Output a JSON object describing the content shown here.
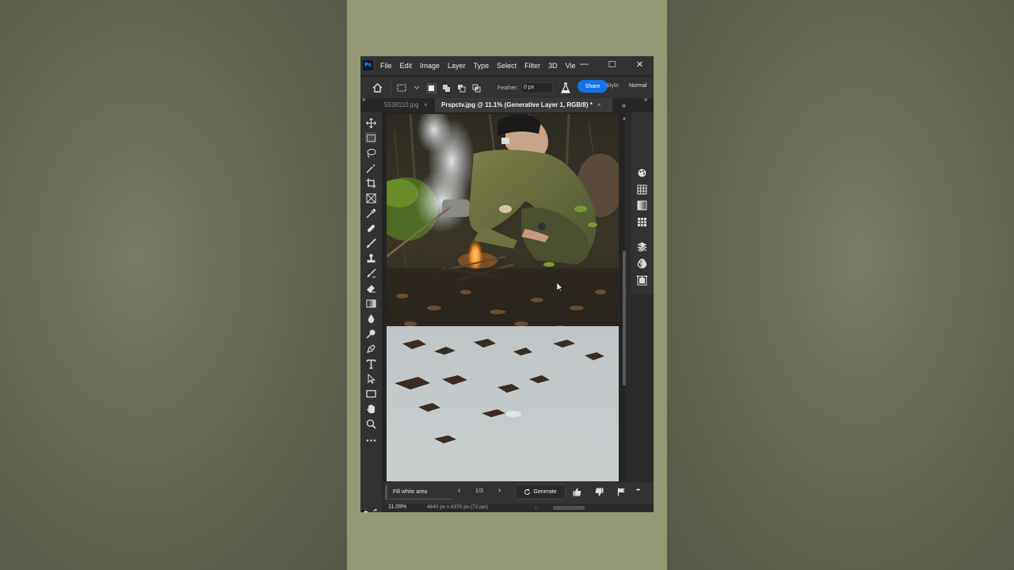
{
  "app": {
    "logo_text": "Ps",
    "menu": [
      "File",
      "Edit",
      "Image",
      "Layer",
      "Type",
      "Select",
      "Filter",
      "3D",
      "Vie"
    ],
    "window_controls": {
      "minimize": "—",
      "maximize": "☐",
      "close": "✕"
    }
  },
  "options_bar": {
    "feather_label": "Feather:",
    "feather_value": "0 px",
    "share_label": "Share",
    "style_label": "Style:",
    "style_value": "Normal"
  },
  "tabs": {
    "inactive_label": "5538110.jpg",
    "active_label": "Prspctv.jpg @ 11.1% (Generative Layer 1, RGB/8) *",
    "close_glyph": "×",
    "overflow_glyph": "»"
  },
  "tools": [
    "move-tool",
    "marquee-tool",
    "lasso-tool",
    "magic-wand-tool",
    "crop-tool",
    "frame-tool",
    "eyedropper-tool",
    "healing-brush-tool",
    "brush-tool",
    "clone-stamp-tool",
    "history-brush-tool",
    "eraser-tool",
    "gradient-tool",
    "blur-tool",
    "dodge-tool",
    "pen-tool",
    "type-tool",
    "path-selection-tool",
    "rectangle-tool",
    "hand-tool",
    "zoom-tool",
    "more-tools"
  ],
  "right_panel_icons": [
    "color-wheel-icon",
    "swatches-icon",
    "gradients-icon",
    "patterns-icon",
    "layers-icon",
    "channels-icon",
    "paths-icon",
    "properties-icon",
    "adjustments-icon",
    "libraries-icon"
  ],
  "generative_bar": {
    "prompt": "Fill white area",
    "counter": "1/3",
    "generate_label": "Generate",
    "more_glyph": "•••"
  },
  "status": {
    "zoom": "11.09%",
    "document_size": "4640 px x 8370 px (72 ppi)"
  },
  "colors": {
    "accent": "#1473e6",
    "panel": "#323232",
    "canvas_bg": "#232323",
    "app_bg": "#2a2a2a",
    "side_bg": "#939877"
  }
}
